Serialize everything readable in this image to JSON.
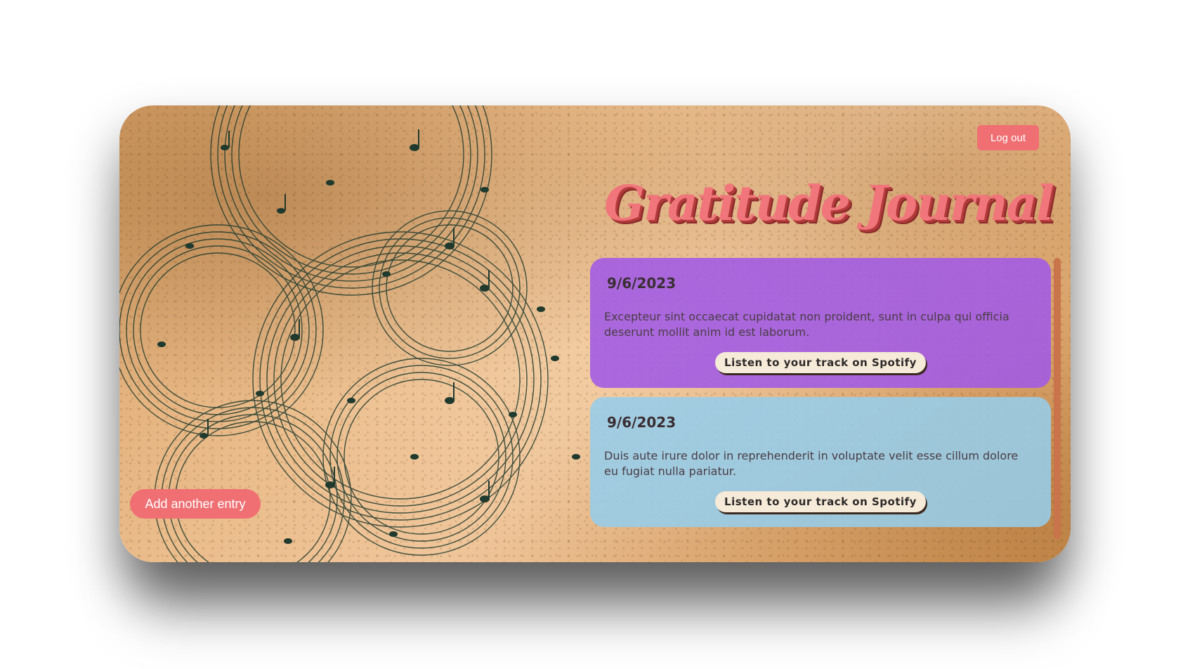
{
  "app": {
    "title": "Gratitude Journal"
  },
  "header": {
    "logout_label": "Log out"
  },
  "sidebar": {
    "add_entry_label": "Add another entry"
  },
  "entries": [
    {
      "date": "9/6/2023",
      "text": "Excepteur sint occaecat cupidatat non proident, sunt in culpa qui officia deserunt mollit anim id est laborum.",
      "button_label": "Listen to your track on Spotify",
      "color": "#a05ae6"
    },
    {
      "date": "9/6/2023",
      "text": "Duis aute irure dolor in reprehenderit in voluptate velit esse cillum dolore eu fugiat nulla pariatur.",
      "button_label": "Listen to your track on Spotify",
      "color": "#96cdeb"
    }
  ],
  "colors": {
    "accent": "#ef6f73",
    "title_shadow": "#b23a3a",
    "paper": "#ebbd8c",
    "music_ink": "#1f3a2e",
    "scrollbar": "#c9744a"
  },
  "icons": {
    "background_art": "sheet-music-swirl"
  }
}
